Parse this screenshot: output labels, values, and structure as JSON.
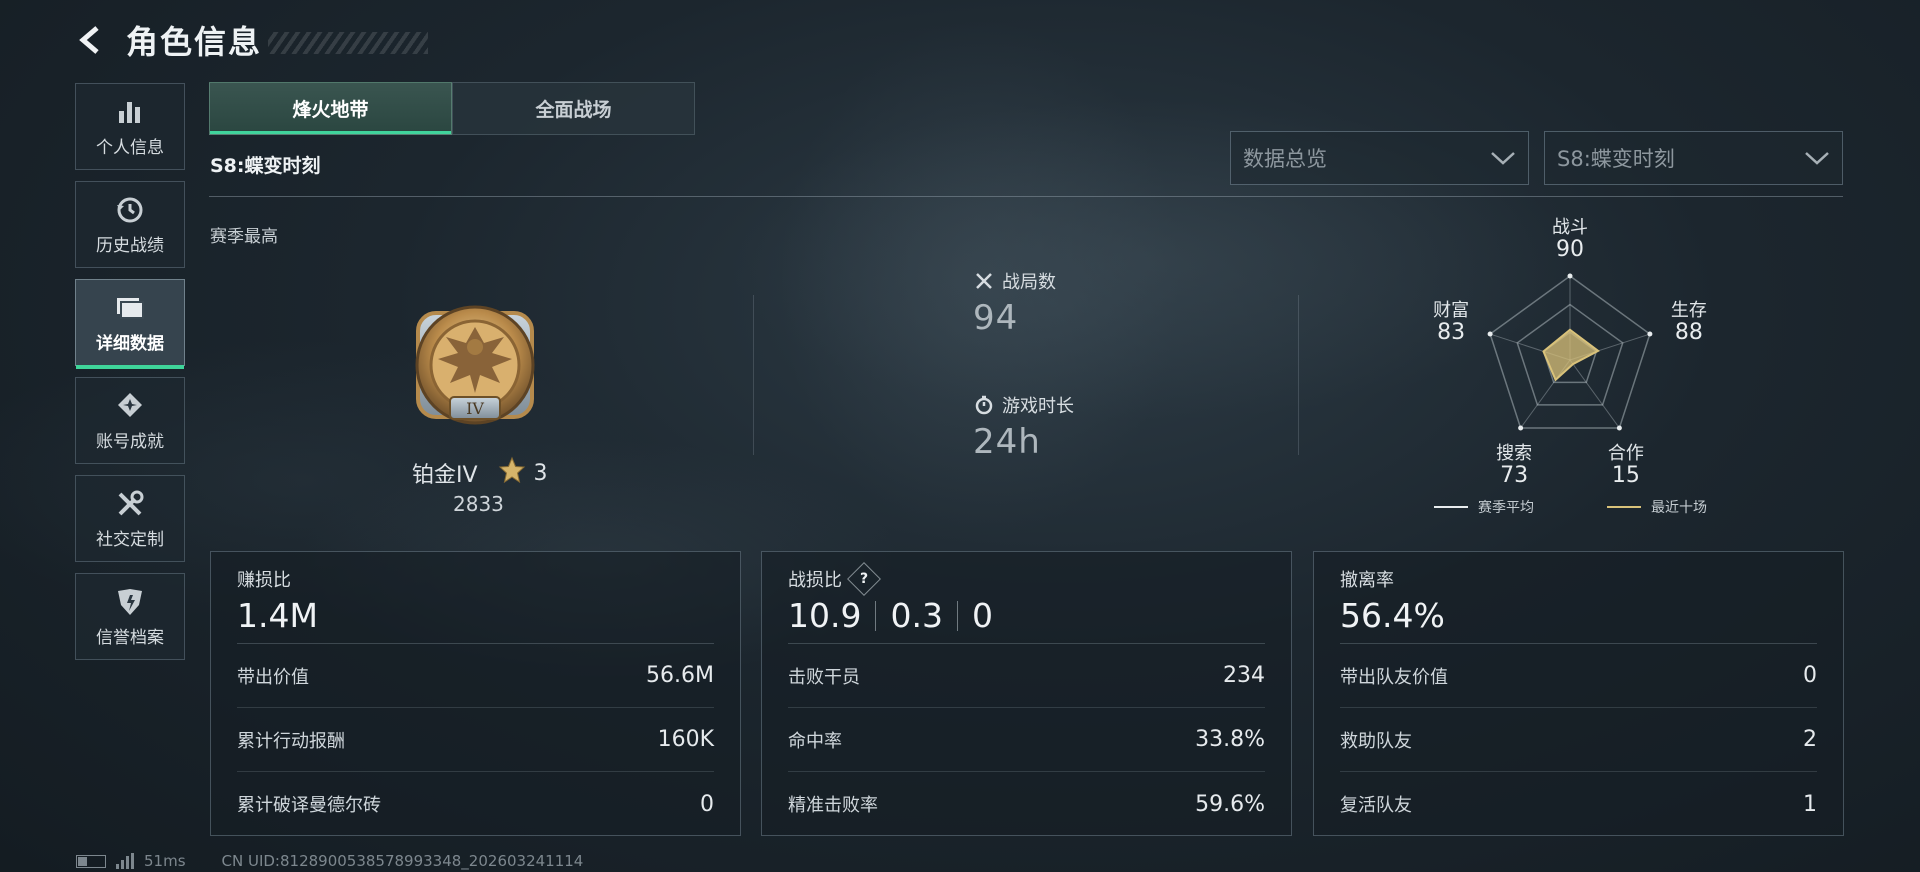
{
  "header": {
    "title": "角色信息"
  },
  "sidebar": {
    "items": [
      {
        "label": "个人信息",
        "icon": "bar-chart-icon"
      },
      {
        "label": "历史战绩",
        "icon": "history-clock-icon"
      },
      {
        "label": "详细数据",
        "icon": "folder-data-icon",
        "active": true
      },
      {
        "label": "账号成就",
        "icon": "achievement-icon"
      },
      {
        "label": "社交定制",
        "icon": "tools-icon"
      },
      {
        "label": "信誉档案",
        "icon": "shield-emblem-icon"
      }
    ]
  },
  "tabs": [
    {
      "label": "烽火地带",
      "active": true
    },
    {
      "label": "全面战场",
      "active": false
    }
  ],
  "season": {
    "title": "S8:蝶变时刻"
  },
  "filters": {
    "view": "数据总览",
    "season": "S8:蝶变时刻"
  },
  "season_best": {
    "label": "赛季最高",
    "rank": "铂金IV",
    "stars": "3",
    "score": "2833",
    "badge_numeral": "IV"
  },
  "stats": {
    "matches_label": "战局数",
    "matches_value": "94",
    "playtime_label": "游戏时长",
    "playtime_value": "24h"
  },
  "radar": {
    "axes": [
      {
        "label": "战斗",
        "value": "90"
      },
      {
        "label": "生存",
        "value": "88"
      },
      {
        "label": "合作",
        "value": "15"
      },
      {
        "label": "搜索",
        "value": "73"
      },
      {
        "label": "财富",
        "value": "83"
      }
    ],
    "legend_avg": "赛季平均",
    "legend_recent": "最近十场",
    "color_avg": "#e8ecee",
    "color_recent": "#d9c27a"
  },
  "cards": [
    {
      "label": "赚损比",
      "big": "1.4M",
      "rows": [
        {
          "k": "带出价值",
          "v": "56.6M"
        },
        {
          "k": "累计行动报酬",
          "v": "160K"
        },
        {
          "k": "累计破译曼德尔砖",
          "v": "0"
        }
      ]
    },
    {
      "label": "战损比",
      "big_parts": [
        "10.9",
        "0.3",
        "0"
      ],
      "help": "?",
      "rows": [
        {
          "k": "击败干员",
          "v": "234"
        },
        {
          "k": "命中率",
          "v": "33.8%"
        },
        {
          "k": "精准击败率",
          "v": "59.6%"
        }
      ]
    },
    {
      "label": "撤离率",
      "big": "56.4%",
      "rows": [
        {
          "k": "带出队友价值",
          "v": "0"
        },
        {
          "k": "救助队友",
          "v": "2"
        },
        {
          "k": "复活队友",
          "v": "1"
        }
      ]
    }
  ],
  "footer": {
    "ping": "51ms",
    "uid": "CN UID:8128900538578993348_202603241114"
  }
}
